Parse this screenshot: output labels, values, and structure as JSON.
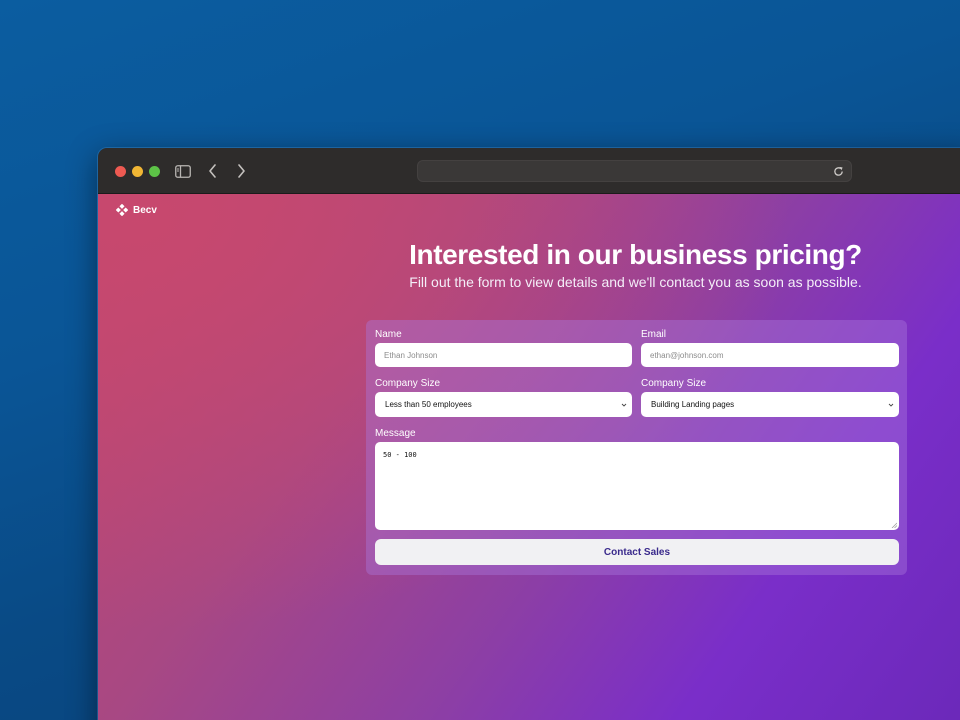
{
  "brand": {
    "name": "Becv"
  },
  "hero": {
    "title": "Interested in our business pricing?",
    "subtitle": "Fill out the form to view details and we'll contact you as soon as possible."
  },
  "form": {
    "name_label": "Name",
    "name_placeholder": "Ethan Johnson",
    "email_label": "Email",
    "email_placeholder": "ethan@johnson.com",
    "company_size_label": "Company Size",
    "company_size_value": "Less than 50 employees",
    "company_size2_label": "Company Size",
    "company_size2_value": "Building Landing pages",
    "message_label": "Message",
    "message_value": "50 - 100",
    "submit_label": "Contact Sales"
  },
  "colors": {
    "accent_button_text": "#3a2a8c",
    "traffic_red": "#ee5a52",
    "traffic_yellow": "#f1b634",
    "traffic_green": "#5dc347"
  },
  "icons": [
    "sidebar-icon",
    "chevron-left-icon",
    "chevron-right-icon",
    "reload-icon",
    "brand-logo-icon",
    "chevron-down-icon"
  ]
}
